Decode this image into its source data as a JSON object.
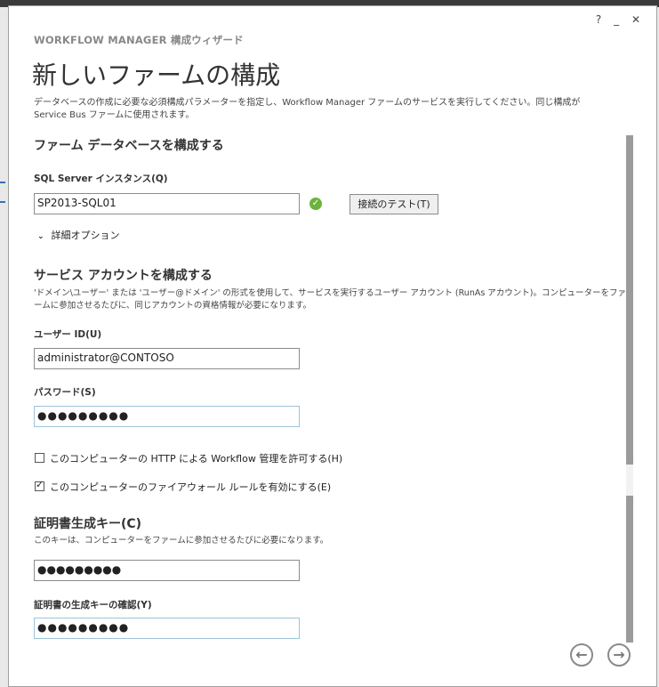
{
  "window": {
    "help": "?",
    "minimize": "_",
    "close": "✕"
  },
  "wizard_label": "WORKFLOW MANAGER 構成ウィザード",
  "page_title": "新しいファームの構成",
  "description": "データベースの作成に必要な必須構成パラメーターを指定し、Workflow Manager ファームのサービスを実行してください。同じ構成が Service Bus ファームに使用されます。",
  "db_section": {
    "heading": "ファーム データベースを構成する",
    "sql_label": "SQL Server インスタンス(Q)",
    "sql_value": "SP2013-SQL01",
    "status_icon": "check-circle-icon",
    "test_button": "接続のテスト(T)",
    "advanced": "詳細オプション"
  },
  "account_section": {
    "heading": "サービス アカウントを構成する",
    "hint": "'ドメイン\\ユーザー' または 'ユーザー@ドメイン' の形式を使用して、サービスを実行するユーザー アカウント (RunAs アカウント)。コンピューターをファームに参加させるたびに、同じアカウントの資格情報が必要になります。",
    "user_label": "ユーザー ID(U)",
    "user_value": "administrator@CONTOSO",
    "password_label": "パスワード(S)",
    "password_value": "●●●●●●●●●"
  },
  "options": {
    "http_label": "このコンピューターの HTTP による Workflow 管理を許可する(H)",
    "http_checked": false,
    "firewall_label": "このコンピューターのファイアウォール ルールを有効にする(E)",
    "firewall_checked": true
  },
  "cert_section": {
    "heading": "証明書生成キー(C)",
    "hint": "このキーは、コンピューターをファームに参加させるたびに必要になります。",
    "key_value": "●●●●●●●●●",
    "confirm_label": "証明書の生成キーの確認(Y)",
    "confirm_value": "●●●●●●●●●"
  },
  "nav": {
    "back": "←",
    "next": "→"
  },
  "colors": {
    "ok_green": "#6cb33e",
    "accent_border": "#9cc4da"
  }
}
